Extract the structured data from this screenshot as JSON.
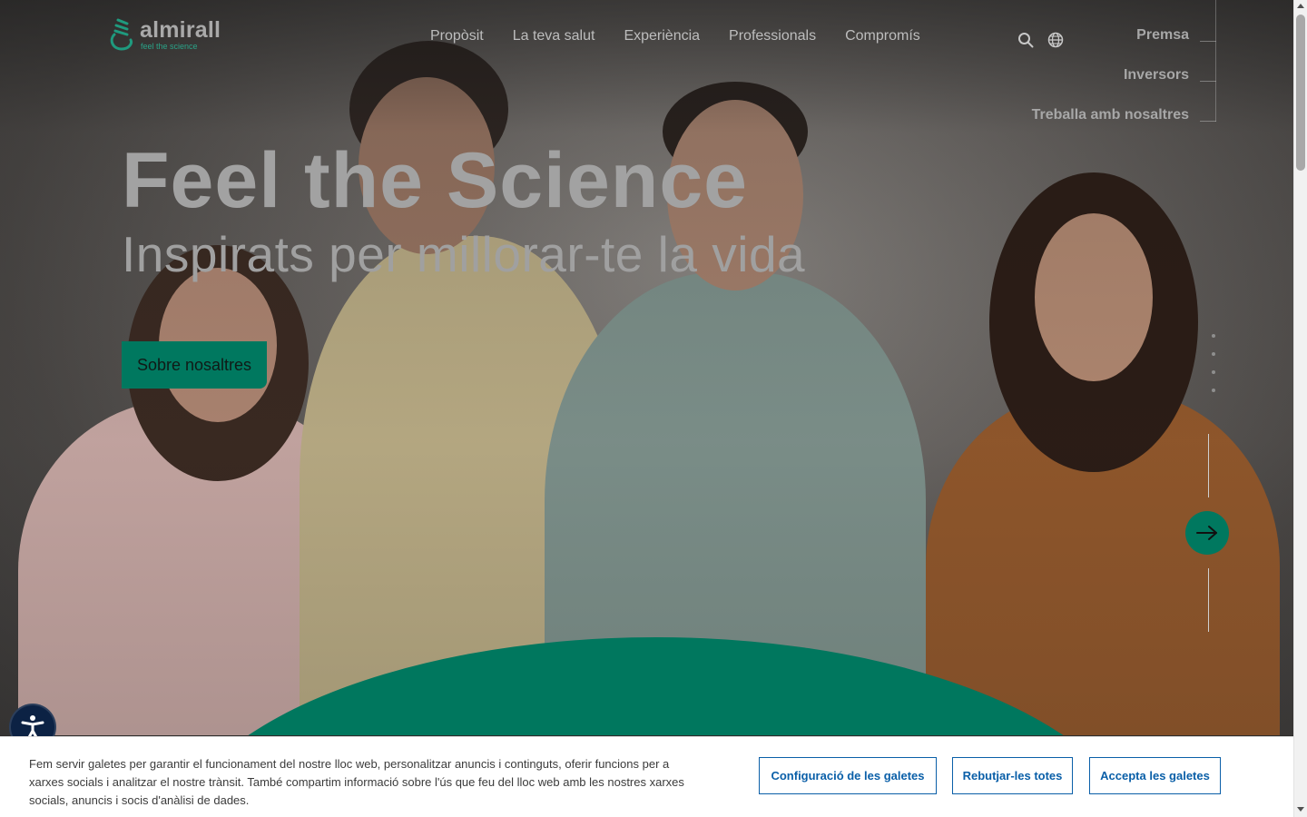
{
  "brand": {
    "name": "almirall",
    "tagline": "feel the science",
    "accent": "#00785f"
  },
  "nav": {
    "items": [
      "Propòsit",
      "La teva salut",
      "Experiència",
      "Professionals",
      "Compromís"
    ]
  },
  "utility_icons": {
    "search": "search-icon",
    "language": "globe-icon"
  },
  "side_links": [
    "Premsa",
    "Inversors",
    "Treballa amb nosaltres"
  ],
  "hero": {
    "title": "Feel the Science",
    "subtitle": "Inspirats per millorar-te la vida",
    "cta": "Sobre nosaltres",
    "slide_dots": 4
  },
  "cookie_banner": {
    "text": "Fem servir galetes per garantir el funcionament del nostre lloc web, personalitzar anuncis i continguts, oferir funcions per a xarxes socials i analitzar el nostre trànsit. També compartim informació sobre l'ús que feu del lloc web amb les nostres xarxes socials, anuncis i socis d'anàlisi de dades.",
    "settings_button": "Configuració de les galetes",
    "reject_button": "Rebutjar-les totes",
    "accept_button": "Accepta les galetes",
    "button_color": "#0a5fa8"
  }
}
